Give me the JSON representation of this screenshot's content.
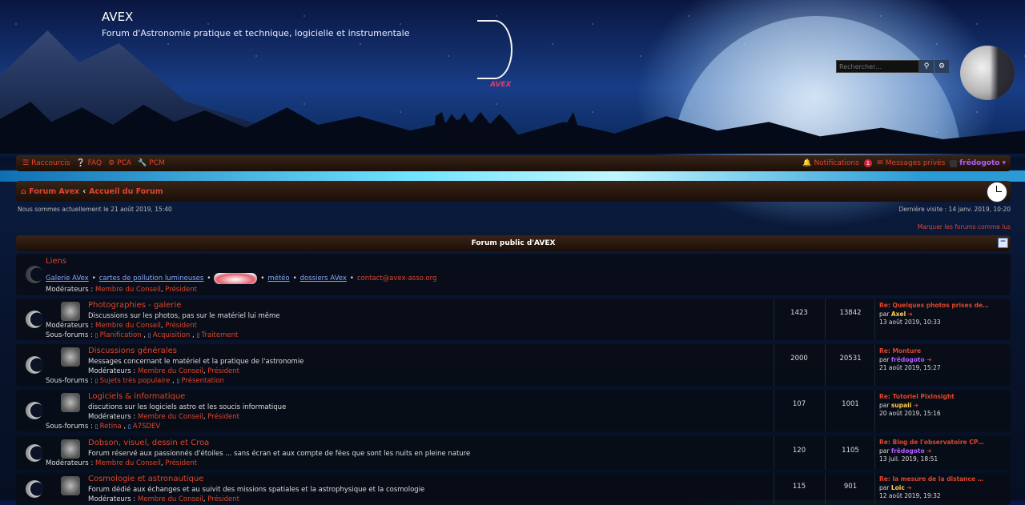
{
  "header": {
    "site_title": "AVEX",
    "site_description": "Forum d'Astronomie pratique et technique, logicielle et instrumentale",
    "logo_text": "AVEX",
    "search_placeholder": "Rechercher…"
  },
  "navbar": {
    "left": [
      {
        "icon": "menu-icon",
        "label": "Raccourcis"
      },
      {
        "icon": "question-icon",
        "label": "FAQ"
      },
      {
        "icon": "cogs-icon",
        "label": "PCA"
      },
      {
        "icon": "wrench-icon",
        "label": "PCM"
      }
    ],
    "notifications_label": "Notifications",
    "notifications_count": "1",
    "messages_label": "Messages privés",
    "username": "frêdogoto"
  },
  "breadcrumb": {
    "home": "Forum Avex",
    "separator": "‹",
    "current": "Accueil du Forum"
  },
  "dates": {
    "now": "Nous sommes actuellement le 21 août 2019, 15:40",
    "last_visit": "Dernière visite : 14 janv. 2019, 10:20"
  },
  "mark_read": "Marquer les forums comme lus",
  "category": {
    "title": "Forum public d'AVEX",
    "collapse": "−"
  },
  "links_row": {
    "title": "Liens",
    "links": [
      "Galerie AVex",
      "cartes de pollution lumineuses",
      "météo",
      "dossiers AVex"
    ],
    "contact": "contact@avex-asso.org",
    "bullet": "•",
    "mod_label": "Modérateurs :",
    "mods": [
      "Membre du Conseil",
      "Président"
    ]
  },
  "forums": [
    {
      "title": "Photographies - galerie",
      "desc": "Discussions sur les photos, pas sur le matériel lui même",
      "mod_label": "Modérateurs :",
      "mods": [
        "Membre du Conseil",
        "Président"
      ],
      "sub_label": "Sous-forums :",
      "subs": [
        "Planification",
        "Acquisition",
        "Traitement"
      ],
      "topics": "1423",
      "posts": "13842",
      "last_title": "Re: Quelques photos prises de…",
      "last_by_label": "par",
      "last_by": "Axel",
      "last_date": "13 août 2019, 10:33"
    },
    {
      "title": "Discussions générales",
      "desc": "Messages concernant le matériel et la pratique de l'astronomie",
      "mod_label": "Modérateurs :",
      "mods": [
        "Membre du Conseil",
        "Président"
      ],
      "sub_label": "Sous-forums :",
      "subs": [
        "Sujets très populaire",
        "Présentation"
      ],
      "topics": "2000",
      "posts": "20531",
      "last_title": "Re: Monture",
      "last_by_label": "par",
      "last_by": "frêdogoto",
      "last_date": "21 août 2019, 15:27"
    },
    {
      "title": "Logiciels & informatique",
      "desc": "discutions sur les logiciels astro et les soucis informatique",
      "mod_label": "Modérateurs :",
      "mods": [
        "Membre du Conseil",
        "Président"
      ],
      "sub_label": "Sous-forums :",
      "subs": [
        "Retina",
        "A7SDEV"
      ],
      "topics": "107",
      "posts": "1001",
      "last_title": "Re: Tutoriel PixInsight",
      "last_by_label": "par",
      "last_by": "supaii",
      "last_date": "20 août 2019, 15:16"
    },
    {
      "title": "Dobson, visuel, dessin et Croa",
      "desc": "Forum réservé aux passionnés d'étoiles ... sans écran et aux compte de fées que sont les nuits en pleine nature",
      "mod_label": "Modérateurs :",
      "mods": [
        "Membre du Conseil",
        "Président"
      ],
      "topics": "120",
      "posts": "1105",
      "last_title": "Re: Blog de l'observatoire CP…",
      "last_by_label": "par",
      "last_by": "frêdogoto",
      "last_date": "13 juil. 2019, 18:51"
    },
    {
      "title": "Cosmologie et astronautique",
      "desc": "Forum dédié aux échanges et au suivit des missions spatiales et la astrophysique et la cosmologie",
      "mod_label": "Modérateurs :",
      "mods": [
        "Membre du Conseil",
        "Président"
      ],
      "topics": "115",
      "posts": "901",
      "last_title": "Re: la mesure de la distance …",
      "last_by_label": "par",
      "last_by": "Loic",
      "last_date": "12 août 2019, 19:32"
    }
  ]
}
